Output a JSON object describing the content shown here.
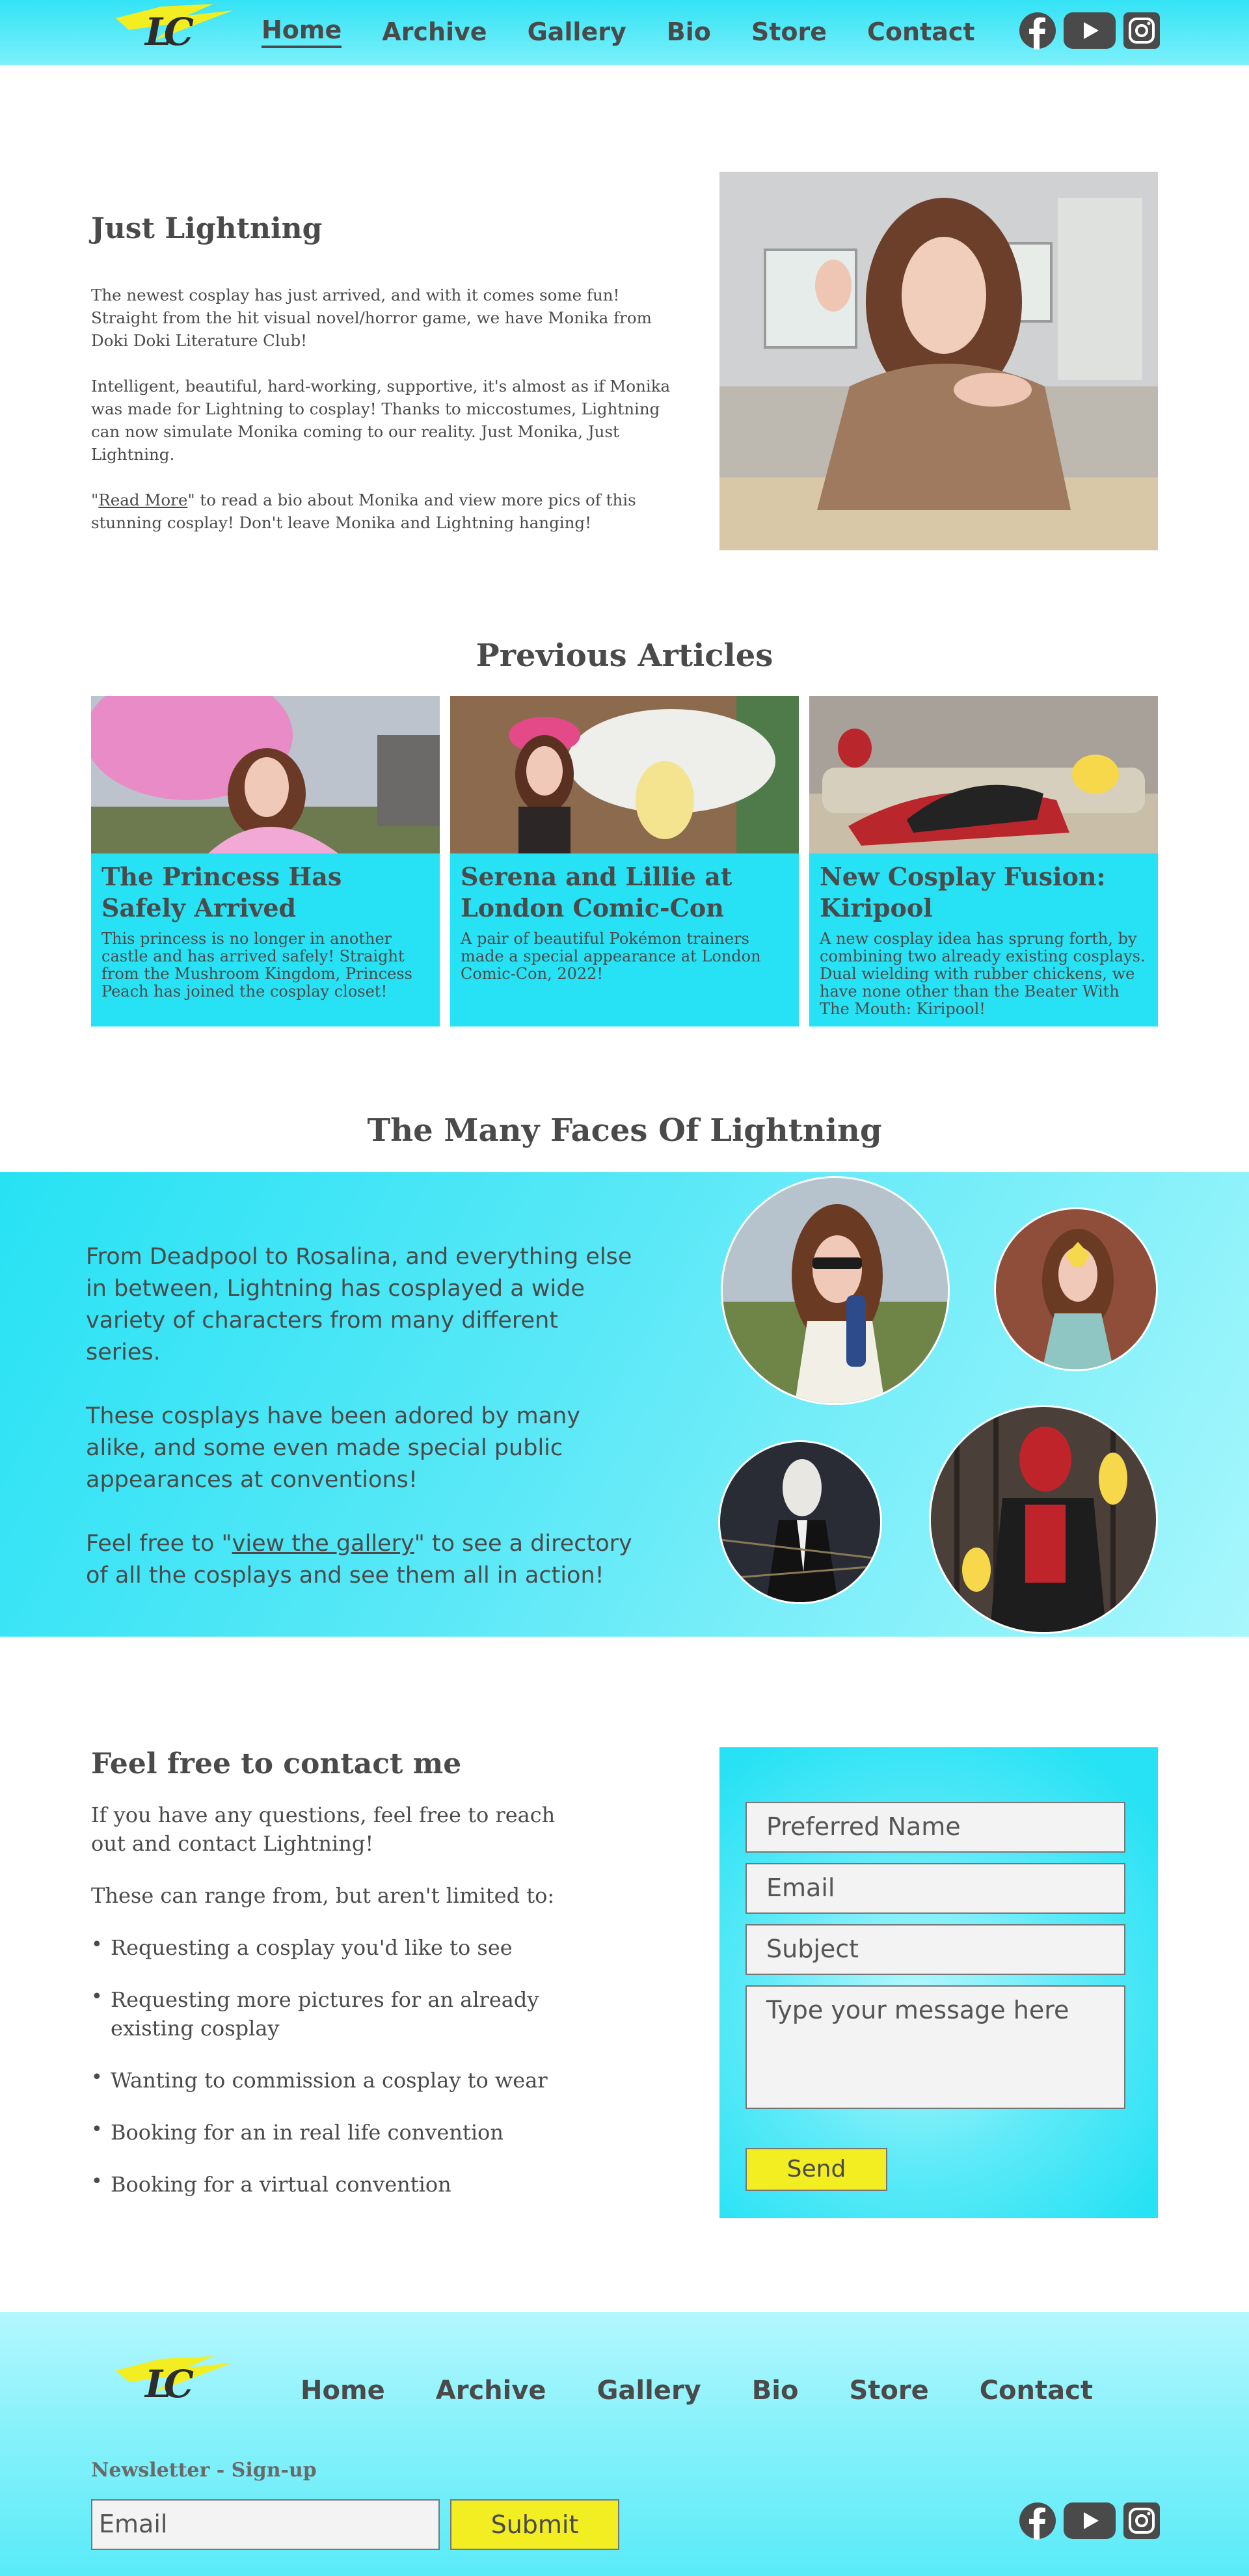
{
  "logo": {
    "text": "LC"
  },
  "nav": {
    "items": [
      "Home",
      "Archive",
      "Gallery",
      "Bio",
      "Store",
      "Contact"
    ],
    "active": "Home"
  },
  "socials": [
    "facebook-icon",
    "youtube-icon",
    "instagram-icon"
  ],
  "hero": {
    "title": "Just Lightning",
    "para1": "The newest cosplay has just arrived, and with it comes some fun! Straight from the hit visual novel/horror game, we have Monika from Doki Doki Literature Club!",
    "para2": "Intelligent, beautiful, hard-working, supportive, it's almost as if Monika was made for Lightning to cosplay! Thanks to miccostumes, Lightning can now simulate Monika coming to our reality. Just Monika, Just Lightning.",
    "para3_prefix": "\"",
    "read_more": "Read More",
    "para3_suffix": "\" to read a bio about Monika and view more pics of this stunning cosplay! Don't leave Monika and Lightning hanging!"
  },
  "articles": {
    "title": "Previous Articles",
    "items": [
      {
        "title": "The Princess Has Safely Arrived",
        "text": "This princess is no longer in another castle and has arrived safely! Straight from the Mushroom Kingdom, Princess Peach has joined the cosplay closet!"
      },
      {
        "title": "Serena and Lillie at London Comic-Con",
        "text": "A pair of beautiful Pokémon trainers made a special appearance at London Comic-Con, 2022!"
      },
      {
        "title": "New Cosplay Fusion: Kiripool",
        "text": "A new cosplay idea has sprung forth, by combining two already existing cosplays. Dual wielding with rubber chickens, we have none other than the Beater With The Mouth: Kiripool!"
      }
    ]
  },
  "faces": {
    "title": "The Many Faces Of Lightning",
    "para1": "From Deadpool to Rosalina, and everything else in between, Lightning has cosplayed a wide variety of characters from many different series.",
    "para2": "These cosplays have been adored by many alike, and some even made special public appearances at conventions!",
    "para3_prefix": "Feel free to \"",
    "gallery_link": "view the gallery",
    "para3_suffix": "\" to see a directory of all the cosplays and see them all in action!"
  },
  "contact": {
    "title": "Feel free to contact me",
    "intro": "If you have any questions, feel free to reach out and contact Lightning!",
    "lead": "These can range from, but aren't limited to:",
    "items": [
      "Requesting a cosplay you'd like to see",
      "Requesting more pictures for an already existing cosplay",
      "Wanting to commission a cosplay to wear",
      "Booking for an in real life convention",
      "Booking for a virtual convention"
    ],
    "form": {
      "name_placeholder": "Preferred Name",
      "email_placeholder": "Email",
      "subject_placeholder": "Subject",
      "message_placeholder": "Type your message here",
      "send_label": "Send"
    }
  },
  "footer": {
    "newsletter_label": "Newsletter - Sign-up",
    "email_placeholder": "Email",
    "submit_label": "Submit"
  },
  "colors": {
    "accent": "#27e2f4",
    "button": "#f3ee22",
    "text": "#4a4a4a"
  }
}
